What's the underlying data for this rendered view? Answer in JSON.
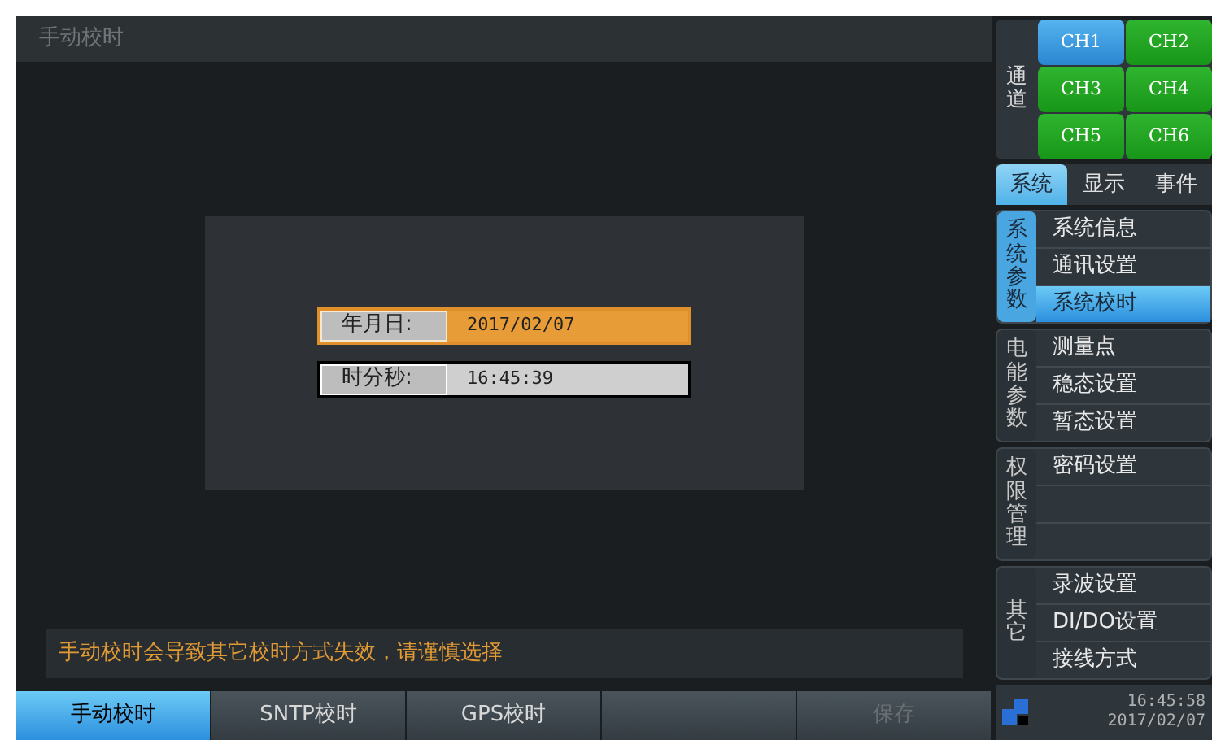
{
  "window": {
    "title": "手动校时"
  },
  "fields": [
    {
      "label": "年月日:",
      "value": "2017/02/07",
      "selected": true
    },
    {
      "label": "时分秒:",
      "value": "16:45:39",
      "selected": false
    }
  ],
  "message": "手动校时会导致其它校时方式失效，请谨慎选择",
  "bottom_buttons": [
    {
      "label": "手动校时",
      "selected": true,
      "disabled": false
    },
    {
      "label": "SNTP校时",
      "selected": false,
      "disabled": false
    },
    {
      "label": "GPS校时",
      "selected": false,
      "disabled": false
    },
    {
      "selected": false
    },
    {
      "label": "保存",
      "selected": false,
      "disabled": true
    }
  ],
  "channels": {
    "label": "通道",
    "items": [
      {
        "label": "CH1",
        "selected": true
      },
      {
        "label": "CH2",
        "selected": false
      },
      {
        "label": "CH3",
        "selected": false
      },
      {
        "label": "CH4",
        "selected": false
      },
      {
        "label": "CH5",
        "selected": false
      },
      {
        "label": "CH6",
        "selected": false
      }
    ]
  },
  "tabs": [
    {
      "label": "系统",
      "selected": true
    },
    {
      "label": "显示",
      "selected": false
    },
    {
      "label": "事件",
      "selected": false
    }
  ],
  "menu_groups": [
    {
      "label": "系统参数",
      "selected": true,
      "items": [
        {
          "kind": "entry",
          "label": "系统信息",
          "selected": false
        },
        {
          "kind": "entry",
          "label": "通讯设置",
          "selected": false
        },
        {
          "kind": "entry",
          "label": "系统校时",
          "selected": true
        }
      ]
    },
    {
      "label": "电能参数",
      "selected": false,
      "items": [
        {
          "kind": "entry",
          "label": "测量点",
          "selected": false
        },
        {
          "kind": "entry",
          "label": "稳态设置",
          "selected": false
        },
        {
          "kind": "entry",
          "label": "暂态设置",
          "selected": false
        }
      ]
    },
    {
      "label": "权限管理",
      "selected": false,
      "items": [
        {
          "kind": "entry",
          "label": "密码设置",
          "selected": false
        },
        {
          "kind": "blank"
        },
        {
          "kind": "blank"
        }
      ]
    },
    {
      "label": "其它",
      "selected": false,
      "items": [
        {
          "kind": "entry",
          "label": "录波设置",
          "selected": false
        },
        {
          "kind": "entry",
          "label": "DI/DO设置",
          "selected": false
        },
        {
          "kind": "entry",
          "label": "接线方式",
          "selected": false
        }
      ]
    }
  ],
  "status": {
    "time": "16:45:58",
    "date": "2017/02/07"
  }
}
